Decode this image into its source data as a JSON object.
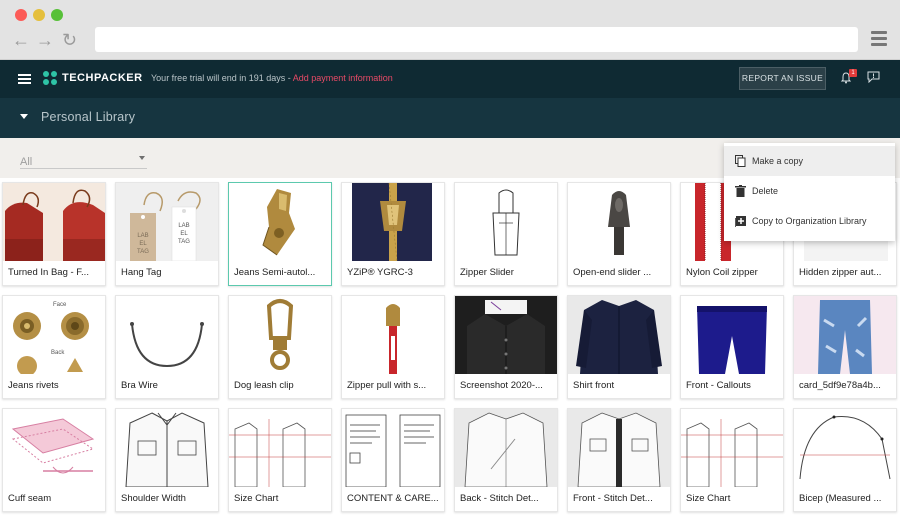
{
  "app": {
    "brand": "TECHPACKER",
    "trial_text": "Your free trial will end in 191 days - ",
    "trial_link": "Add payment information",
    "report_button": "REPORT AN ISSUE",
    "notification_count": "1",
    "accent_color": "#2ec4a6",
    "header_color": "#0f2a33"
  },
  "library": {
    "title": "Personal Library"
  },
  "filter": {
    "selected": "All"
  },
  "context_menu": {
    "items": [
      {
        "label": "Make a copy",
        "icon": "copy-icon"
      },
      {
        "label": "Delete",
        "icon": "trash-icon"
      },
      {
        "label": "Copy to Organization Library",
        "icon": "add-box-icon"
      }
    ]
  },
  "cards": [
    {
      "label": "Turned In Bag - F..."
    },
    {
      "label": "Hang Tag"
    },
    {
      "label": "Jeans Semi-autol..."
    },
    {
      "label": "YZiP® YGRC-3"
    },
    {
      "label": "Zipper Slider"
    },
    {
      "label": "Open-end slider ..."
    },
    {
      "label": "Nylon Coil zipper"
    },
    {
      "label": "Hidden zipper aut..."
    },
    {
      "label": "Jeans rivets"
    },
    {
      "label": "Bra Wire"
    },
    {
      "label": "Dog leash clip"
    },
    {
      "label": "Zipper pull with s..."
    },
    {
      "label": "Screenshot 2020-..."
    },
    {
      "label": "Shirt front"
    },
    {
      "label": "Front - Callouts"
    },
    {
      "label": "card_5df9e78a4b..."
    },
    {
      "label": "Cuff seam"
    },
    {
      "label": "Shoulder Width"
    },
    {
      "label": "Size Chart"
    },
    {
      "label": "CONTENT & CARE..."
    },
    {
      "label": "Back - Stitch Det..."
    },
    {
      "label": "Front - Stitch Det..."
    },
    {
      "label": "Size Chart"
    },
    {
      "label": "Bicep (Measured ..."
    }
  ],
  "image_text": {
    "label_tag": "LAB EL TAG",
    "rivet_face": "Face",
    "rivet_back": "Back"
  }
}
